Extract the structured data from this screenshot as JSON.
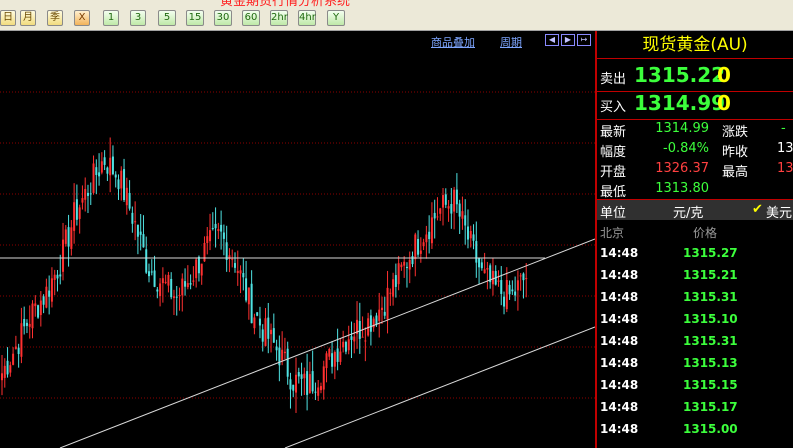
{
  "window": {
    "title_fragment": "黄金期货行情分析系统"
  },
  "toolbar": {
    "buttons": [
      {
        "label": "日",
        "style": "yellow"
      },
      {
        "label": "月",
        "style": "yellow"
      },
      {
        "label": "季",
        "style": "yellow"
      },
      {
        "label": "X",
        "style": "orange"
      },
      {
        "label": "1",
        "style": "green"
      },
      {
        "label": "3",
        "style": "green"
      },
      {
        "label": "5",
        "style": "green"
      },
      {
        "label": "15",
        "style": "green"
      },
      {
        "label": "30",
        "style": "green"
      },
      {
        "label": "60",
        "style": "green"
      },
      {
        "label": "2hr",
        "style": "green"
      },
      {
        "label": "4hr",
        "style": "green"
      },
      {
        "label": "Y",
        "style": "green"
      }
    ]
  },
  "chart_header": {
    "overlay_label": "商品叠加",
    "period_label": "周期",
    "nav_icons": [
      "arrow-left-icon",
      "arrow-right-icon",
      "exit-icon"
    ]
  },
  "colors": {
    "up": "#ff3030",
    "down": "#4fe3e3",
    "grid": "#8b0000",
    "trendline": "#d9d9d9",
    "buy_sell_price": "#3cff3c",
    "volume": "#ffff00",
    "rise_value": "#ff4040",
    "fall_value": "#3cff3c"
  },
  "chart_data": {
    "type": "candlestick",
    "note_channel": "ascending channel drawn with two parallel trendlines and one horizontal resistance line",
    "candles_estimated": [
      1314.2,
      1315.0,
      1315.9,
      1316.5,
      1317.4,
      1318.8,
      1319.6,
      1320.4,
      1319.9,
      1318.7,
      1317.3,
      1316.8,
      1316.4,
      1317.0,
      1317.8,
      1318.2,
      1317.5,
      1316.2,
      1315.4,
      1314.8,
      1314.0,
      1313.8,
      1314.3,
      1314.9,
      1315.4,
      1315.6,
      1316.1,
      1316.8,
      1317.6,
      1318.3,
      1318.9,
      1319.2,
      1318.1,
      1317.0,
      1316.6,
      1316.4,
      1317.0
    ]
  },
  "quote_panel": {
    "product_name": "现货黄金(AU)",
    "sell": {
      "label": "卖出",
      "price": "1315.22",
      "volume": "0"
    },
    "buy": {
      "label": "买入",
      "price": "1314.99",
      "volume": "0"
    },
    "stats": [
      {
        "label": "最新",
        "value": "1314.99",
        "color": "green"
      },
      {
        "label": "涨跌",
        "value": "",
        "color": "green"
      },
      {
        "label": "幅度",
        "value": "-0.84%",
        "color": "green"
      },
      {
        "label": "昨收",
        "value": "13",
        "color": "white"
      },
      {
        "label": "开盘",
        "value": "1326.37",
        "color": "red"
      },
      {
        "label": "最高",
        "value": "13",
        "color": "red"
      },
      {
        "label": "最低",
        "value": "1313.80",
        "color": "green"
      }
    ],
    "unit": {
      "label": "单位",
      "value": "元/克",
      "currency": "美元",
      "currency_checked": true
    },
    "ticks_header": {
      "time": "北京",
      "price": "价格"
    },
    "ticks": [
      {
        "time": "14:48",
        "price": "1315.27"
      },
      {
        "time": "14:48",
        "price": "1315.21"
      },
      {
        "time": "14:48",
        "price": "1315.31"
      },
      {
        "time": "14:48",
        "price": "1315.10"
      },
      {
        "time": "14:48",
        "price": "1315.31"
      },
      {
        "time": "14:48",
        "price": "1315.13"
      },
      {
        "time": "14:48",
        "price": "1315.15"
      },
      {
        "time": "14:48",
        "price": "1315.17"
      },
      {
        "time": "14:48",
        "price": "1315.00"
      }
    ]
  }
}
